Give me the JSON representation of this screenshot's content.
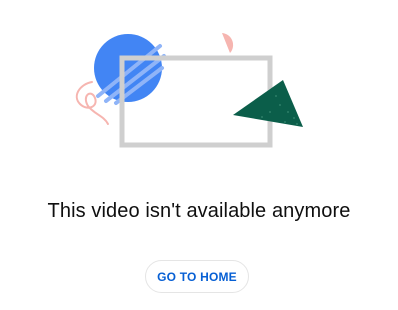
{
  "error_page": {
    "message": "This video isn't available anymore",
    "home_button_label": "GO TO HOME"
  },
  "illustration": {
    "icons": [
      "blue-circle-icon",
      "pink-squiggle-icon",
      "pink-semicircle-icon",
      "video-frame-icon",
      "green-triangle-icon"
    ]
  },
  "colors": {
    "blue_circle": "#4285f4",
    "frame": "#cfcfcf",
    "green_triangle": "#0b5e4a",
    "pink_accent": "#f6b5b0",
    "button_text": "#065fd4",
    "message_text": "#0f0f0f"
  }
}
